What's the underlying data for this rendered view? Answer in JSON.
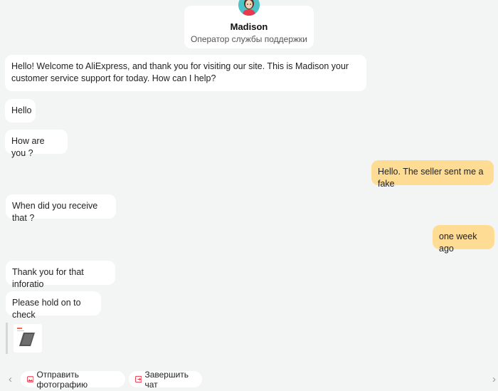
{
  "agent": {
    "name": "Madison",
    "role": "Оператор службы поддержки"
  },
  "messages": [
    {
      "text": "Hello! Welcome to AliExpress, and thank you for visiting our site. This is  Madison your customer service support for today. How can I help?",
      "from": "agent"
    },
    {
      "text": "Hello",
      "from": "agent"
    },
    {
      "text": "How are you ?",
      "from": "agent"
    },
    {
      "text": "Hello. The seller sent me a fake",
      "from": "user"
    },
    {
      "text": "When did you receive that ?",
      "from": "agent"
    },
    {
      "text": "one week ago",
      "from": "user"
    },
    {
      "text": "Thank you for that inforatio",
      "from": "agent"
    },
    {
      "text": "Please hold on to check",
      "from": "agent"
    }
  ],
  "quick_actions": {
    "send_photo": "Отправить фотографию",
    "end_chat": "Завершить чат"
  },
  "colors": {
    "background": "#f3f4f4",
    "user_bubble": "#ffdc93",
    "agent_bubble": "#ffffff",
    "action_icon": "#e8394d"
  },
  "icons": [
    "avatar",
    "image-icon",
    "end-chat-icon",
    "chevron-left-icon",
    "chevron-right-icon"
  ]
}
